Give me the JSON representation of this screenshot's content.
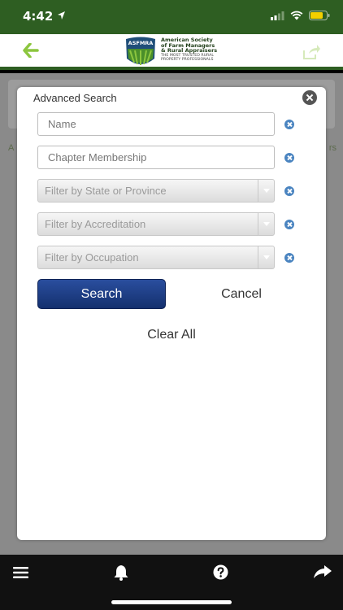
{
  "status_bar": {
    "time": "4:42",
    "icons": [
      "location-arrow-icon",
      "cellular-signal-icon",
      "wifi-icon",
      "battery-icon"
    ]
  },
  "header": {
    "logo": {
      "badge_text": "ASFMRA",
      "lines": [
        "American Society",
        "of Farm Managers",
        "& Rural Appraisers"
      ],
      "tagline": [
        "THE MOST TRUSTED RURAL",
        "PROPERTY PROFESSIONALS"
      ]
    },
    "back_icon": "left-arrow-icon",
    "share_icon": "share-icon"
  },
  "background_edge_text": {
    "left": "A",
    "right": "rs"
  },
  "modal": {
    "title": "Advanced Search",
    "fields": [
      {
        "placeholder": "Name"
      },
      {
        "placeholder": "Chapter Membership"
      }
    ],
    "filters": [
      {
        "label": "Filter by State or Province"
      },
      {
        "label": "Filter by Accreditation"
      },
      {
        "label": "Filter by Occupation"
      }
    ],
    "buttons": {
      "search": "Search",
      "cancel": "Cancel",
      "clear_all": "Clear All"
    }
  },
  "toolbar": {
    "icons": [
      "menu-icon",
      "bell-icon",
      "help-icon",
      "share-arrow-icon"
    ]
  },
  "colors": {
    "brand_green": "#2e5e22",
    "accent_green": "#8cc63f",
    "search_button": "#1f3f86",
    "clear_icon": "#4a84c0"
  }
}
